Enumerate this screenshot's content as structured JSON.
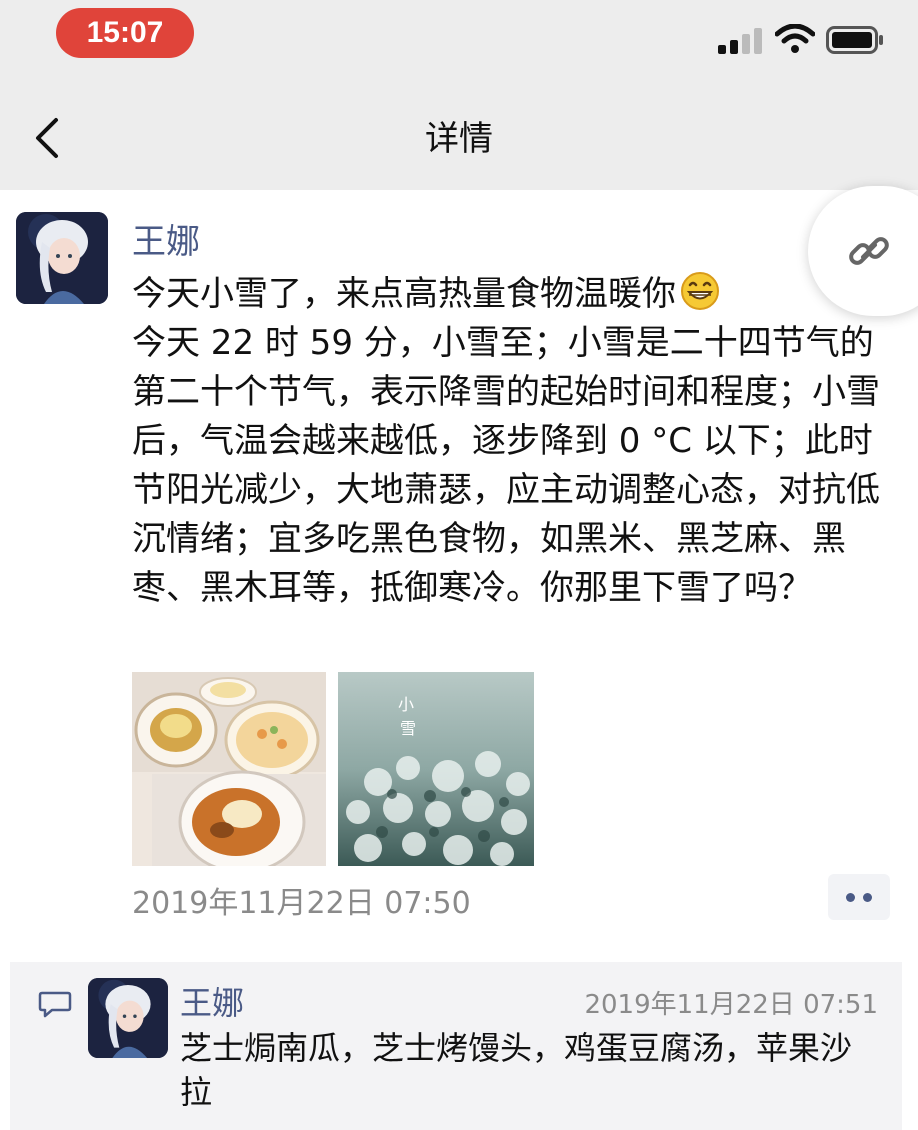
{
  "status_bar": {
    "time": "15:07",
    "time_pill_color": "#e0443a",
    "icons": [
      "cellular-signal-icon",
      "wifi-icon",
      "battery-icon"
    ]
  },
  "nav": {
    "back_icon": "chevron-left-icon",
    "title": "详情"
  },
  "post": {
    "author": "王娜",
    "lines": [
      "今天小雪了，来点高热量食物温暖你",
      "今天 22 时 59 分，小雪至；小雪是二十四节气的第二十个节气，表示降雪的起始时间和程度；小雪后，气温会越来越低，逐步降到 0 °C 以下；此时节阳光减少，大地萧瑟，应主动调整心态，对抗低沉情绪；宜多吃黑色食物，如黑米、黑芝麻、黑枣、黑木耳等，抵御寒冷。你那里下雪了吗？"
    ],
    "emoji": "grinning-face-emoji",
    "images": [
      {
        "name": "food-photo"
      },
      {
        "name": "snow-photo",
        "overlay_text": "小雪"
      }
    ],
    "time": "2019年11月22日 07:50",
    "more_icon": "more-dots-icon",
    "link_icon": "link-icon"
  },
  "comments": [
    {
      "author": "王娜",
      "time": "2019年11月22日 07:51",
      "text": "芝士焗南瓜，芝士烤馒头，鸡蛋豆腐汤，苹果沙拉"
    }
  ],
  "colors": {
    "name_link": "#4a5a86",
    "timestamp": "#8a8a8a",
    "header_bg": "#ededed",
    "comment_bg": "#f3f3f5"
  }
}
